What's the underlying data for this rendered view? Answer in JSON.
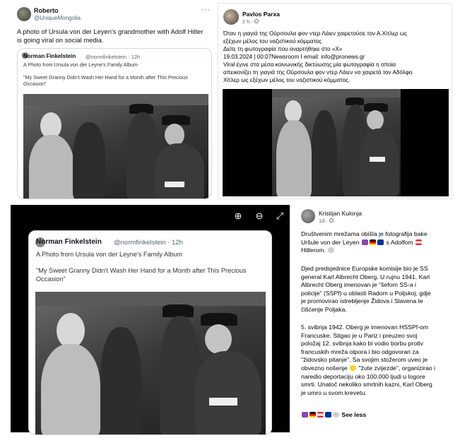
{
  "panel_a": {
    "author_name": "Roberto",
    "author_handle": "@UniqueMongolia",
    "more_label": "···",
    "tweet_text": "A photo of Ursula von der Leyen's grandmother with Adolf Hitler is going viral on social media.",
    "quote": {
      "author_name": "Norman Finkelstein",
      "author_handle": "@normfinkelstein · 12h",
      "line1": "A Photo from Ursula von der Leyne's Family Album",
      "line2": "\"My Sweet Granny Didn't Wash Her Hand for a Month after This Precious Occasion\""
    }
  },
  "panel_b": {
    "author_name": "Pavlos Parxa",
    "time": "2 h · ",
    "line1": "Όταν η γιαγιά της Ούρσουλα φον ντερ Λάιεν χαιρετούσε τον Α.Χίτλερ ως",
    "line2": "εξέχων μέλος του ναζιστικού κόμματος",
    "line3": "Δείτε τη φωτογραφία που αναρτήθηκε στο «Χ»",
    "line4": "19.03.2024 | 00:07Newsroom I email: info@pronews.gr",
    "line5": "Viral έγινε στα μέσα κοινωνικής δικτύωσης μία φωτογραφία η οποία",
    "line6": "απεικονίζει τη γιαγιά της Ούρσουλα φον ντερ Λάιεν να χαιρετά τον Αδόλφο",
    "line7": "Χίτλερ ως εξέχων μέλος του ναζιστικού κόμματος."
  },
  "panel_c": {
    "zoom_in": "⊕",
    "zoom_out": "⊖",
    "expand": "⤢",
    "quote": {
      "author_name": "Norman Finkelstein",
      "author_handle": "@normfinkelstein · 12h",
      "line1": "A Photo from Ursula von der Leyne's Family Album",
      "line2": "\"My Sweet Granny Didn't Wash Her Hand for a Month after This Precious",
      "line3": "Occasion\""
    }
  },
  "panel_d": {
    "author_name": "Kristijan Kulonja",
    "time": "1d · ",
    "p1_a": "Društvenim mrežama obišla je fotografija bake",
    "p1_b": "Uršule von der Leyen",
    "p1_c": "s Adolfom",
    "p1_d": "Hitlerom.",
    "p2_lines": [
      "Djed predsjednice Europske komisije bio je SS",
      "general Karl Albrecht Oberg. U rujnu 1941. Karl",
      "Albrecht Oberg imenovan je \"šefom SS-a i",
      "policije\" (SSPf) u oblasti Radom u Poljskoj, gdje",
      "je promovirao istrebljenje Židova i Slavena te",
      "čišćenje Poljaka."
    ],
    "p3_lines": [
      "5. svibnja 1942. Oberg je imenovan HSSPf-om",
      "Francuske. Stigao je u Pariz i preuzeo svoj",
      "položaj 12. svibnja kako bi vodio borbu protiv",
      "francuskih mreža otpora i bio odgovoran za",
      "\"židovsko pitanje\". Sa svojim stožerom uveo je",
      "obvezno nošenje",
      "\"žute zvijezde\", organizirao i",
      "naredio deportaciju oko 100.000 ljudi u logore",
      "smrti. Unatoč nekoliko smrtnih kazni, Karl Oberg",
      "je umro u svom krevetu."
    ],
    "see_less": "See less"
  }
}
